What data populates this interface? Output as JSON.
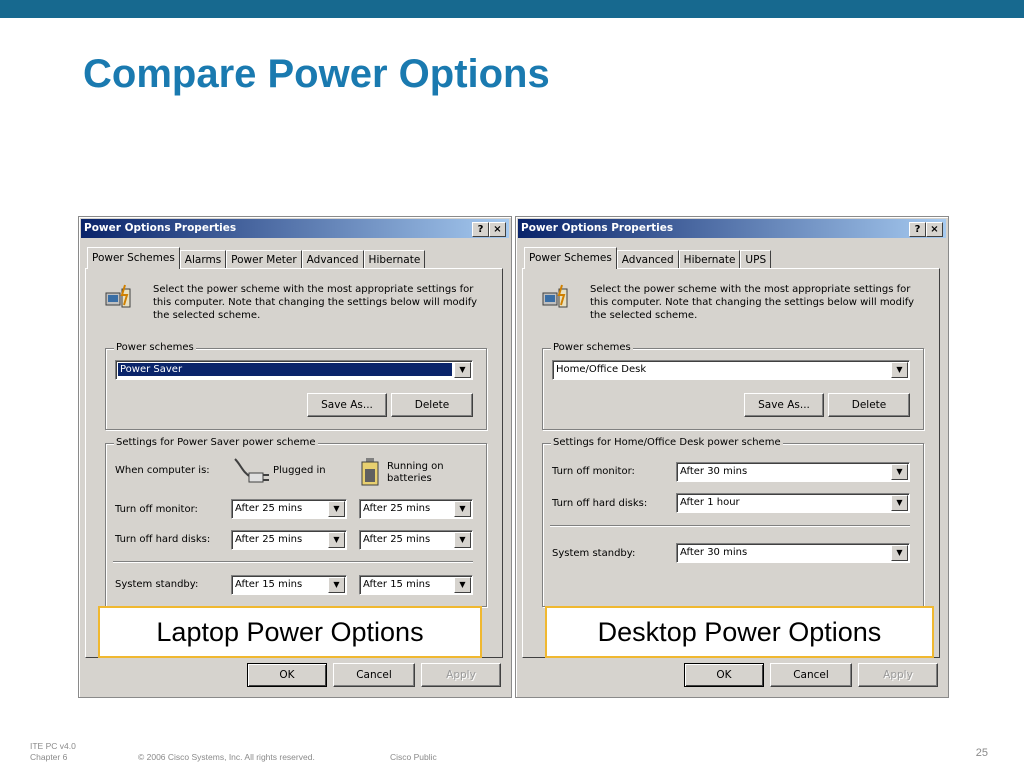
{
  "slide": {
    "title": "Compare Power Options",
    "accent_color": "#17698f",
    "title_color": "#1a7ab0"
  },
  "laptop": {
    "title": "Power Options Properties",
    "help_glyph": "?",
    "close_glyph": "×",
    "tabs": [
      "Power Schemes",
      "Alarms",
      "Power Meter",
      "Advanced",
      "Hibernate"
    ],
    "intro": "Select the power scheme with the most appropriate settings for this computer. Note that changing the settings below will modify the selected scheme.",
    "schemes_legend": "Power schemes",
    "scheme_value": "Power Saver",
    "save_as": "Save As...",
    "delete": "Delete",
    "settings_legend": "Settings for Power Saver power scheme",
    "when_label": "When computer is:",
    "plugged_in": "Plugged in",
    "on_batteries": "Running on batteries",
    "monitor_label": "Turn off monitor:",
    "monitor_plugged": "After 25 mins",
    "monitor_battery": "After 25 mins",
    "disks_label": "Turn off hard disks:",
    "disks_plugged": "After 25 mins",
    "disks_battery": "After 25 mins",
    "standby_label": "System standby:",
    "standby_plugged": "After 15 mins",
    "standby_battery": "After 15 mins",
    "ok": "OK",
    "cancel": "Cancel",
    "apply": "Apply",
    "callout": "Laptop Power Options"
  },
  "desktop": {
    "title": "Power Options Properties",
    "help_glyph": "?",
    "close_glyph": "×",
    "tabs": [
      "Power Schemes",
      "Advanced",
      "Hibernate",
      "UPS"
    ],
    "intro": "Select the power scheme with the most appropriate settings for this computer. Note that changing the settings below will modify the selected scheme.",
    "schemes_legend": "Power schemes",
    "scheme_value": "Home/Office Desk",
    "save_as": "Save As...",
    "delete": "Delete",
    "settings_legend": "Settings for Home/Office Desk power scheme",
    "monitor_label": "Turn off monitor:",
    "monitor_value": "After 30 mins",
    "disks_label": "Turn off hard disks:",
    "disks_value": "After 1 hour",
    "standby_label": "System standby:",
    "standby_value": "After 30 mins",
    "ok": "OK",
    "cancel": "Cancel",
    "apply": "Apply",
    "callout": "Desktop Power Options"
  },
  "footer": {
    "course": "ITE PC v4.0",
    "chapter": "Chapter 6",
    "copyright": "© 2006 Cisco Systems, Inc. All rights reserved.",
    "classification": "Cisco Public",
    "page": "25"
  },
  "icons": {
    "info": "power-scheme-icon",
    "plug": "plug-icon",
    "battery": "battery-icon",
    "dropdown": "chevron-down-icon"
  }
}
